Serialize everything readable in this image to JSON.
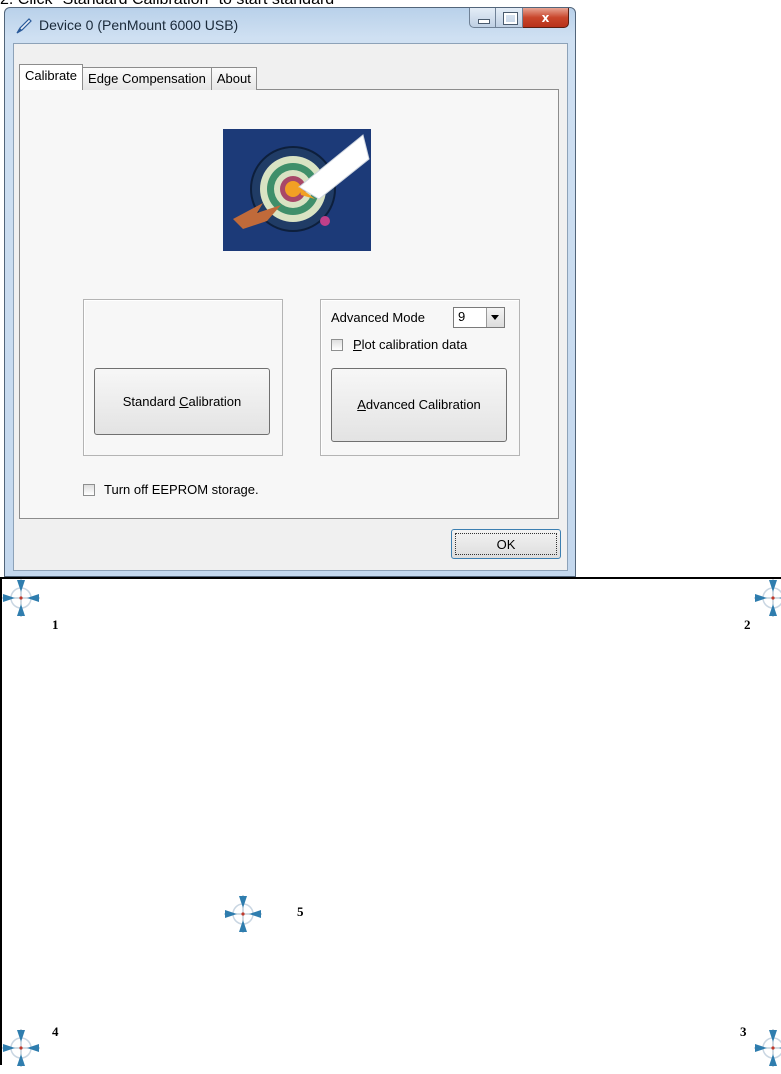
{
  "caption": "2. Click \"Standard Calibration\" to start standard",
  "window": {
    "title": "Device 0 (PenMount 6000 USB)",
    "close_glyph": "x"
  },
  "tabs": [
    {
      "label": "Calibrate",
      "active": true
    },
    {
      "label": "Edge Compensation",
      "active": false
    },
    {
      "label": "About",
      "active": false
    }
  ],
  "standard": {
    "pre": "Standard ",
    "key": "C",
    "post": "alibration"
  },
  "advanced": {
    "mode_label": "Advanced Mode",
    "mode_value": "9",
    "plot_key": "P",
    "plot_rest": "lot calibration data",
    "plot_checked": false,
    "btn_key": "A",
    "btn_rest": "dvanced Calibration"
  },
  "eeprom": {
    "label": "Turn off EEPROM storage.",
    "checked": false
  },
  "ok_label": "OK",
  "targets": [
    {
      "id": "1",
      "label": "1"
    },
    {
      "id": "2",
      "label": "2"
    },
    {
      "id": "3",
      "label": "3"
    },
    {
      "id": "4",
      "label": "4"
    },
    {
      "id": "5",
      "label": "5"
    }
  ],
  "colors": {
    "target_blue": "#2f7dae",
    "dialog_bg": "#f0f0f0",
    "logo_bg": "#1c3a78"
  }
}
